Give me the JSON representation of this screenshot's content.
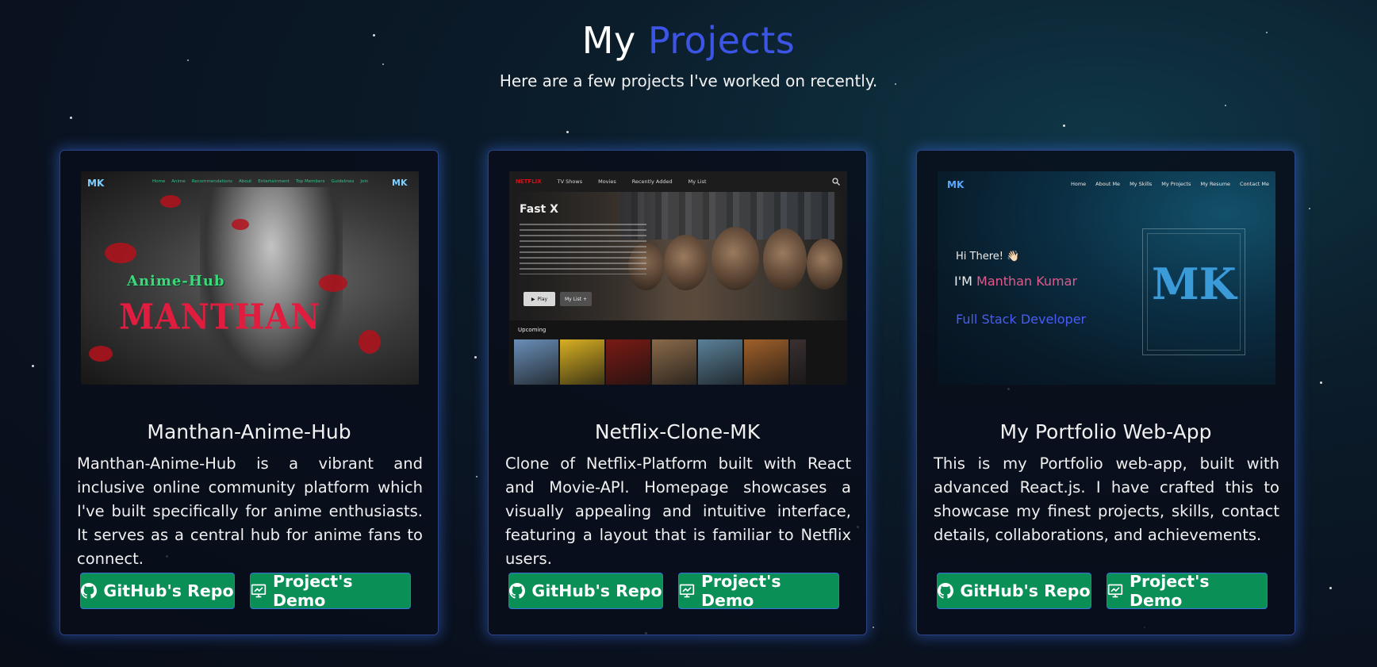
{
  "header": {
    "title_prefix": "My",
    "title_accent": "Projects",
    "subtitle": "Here are a few projects I've worked on recently."
  },
  "colors": {
    "accent": "#3d55e6",
    "button_bg": "#0a8f57",
    "button_border": "#3b6fe0",
    "card_glow": "#3c6ee6"
  },
  "projects": [
    {
      "title": "Manthan-Anime-Hub",
      "description": "Manthan-Anime-Hub is a vibrant and inclusive online community platform which I've built specifically for anime enthusiasts. It serves as a central hub for anime fans to connect.",
      "repo_label": "GitHub's Repo",
      "demo_label": "Project's Demo",
      "repo_icon": "github-icon",
      "demo_icon": "presentation-icon",
      "preview": {
        "logo": "MK",
        "logo_right": "MK",
        "nav": [
          "Home",
          "Anime",
          "Recommendations",
          "About",
          "Entertainment",
          "Top Members",
          "Guidelines",
          "Join"
        ],
        "heading": "Anime-Hub",
        "name": "MANTHAN"
      }
    },
    {
      "title": "Netflix-Clone-MK",
      "description": "Clone of Netflix-Platform built with React and Movie-API. Homepage showcases a visually appealing and intuitive interface, featuring a layout that is familiar to Netflix users.",
      "repo_label": "GitHub's Repo",
      "demo_label": "Project's Demo",
      "repo_icon": "github-icon",
      "demo_icon": "presentation-icon",
      "preview": {
        "brand": "NETFLIX",
        "nav": [
          "TV Shows",
          "Movies",
          "Recently Added",
          "My List"
        ],
        "movie_title": "Fast X",
        "play_label": "Play",
        "mylist_label": "My List  +",
        "row_title": "Upcoming",
        "poster_colors": [
          "#6a8fb8",
          "#d8b022",
          "#7a1a14",
          "#8a6a4a",
          "#5a8098",
          "#a0602a",
          "#3a3030"
        ]
      }
    },
    {
      "title": "My Portfolio Web-App",
      "description": "This is my Portfolio web-app, built with advanced React.js. I have crafted this to showcase my finest projects, skills, contact details, collaborations, and achievements.",
      "repo_label": "GitHub's Repo",
      "demo_label": "Project's Demo",
      "repo_icon": "github-icon",
      "demo_icon": "presentation-icon",
      "preview": {
        "logo": "MK",
        "nav": [
          "Home",
          "About Me",
          "My Skills",
          "My Projects",
          "My Resume",
          "Contact Me"
        ],
        "greeting": "Hi There! 👋🏻",
        "im": "I'M",
        "name": "Manthan Kumar",
        "role": "Full Stack Developer",
        "emblem": "MK"
      }
    }
  ]
}
